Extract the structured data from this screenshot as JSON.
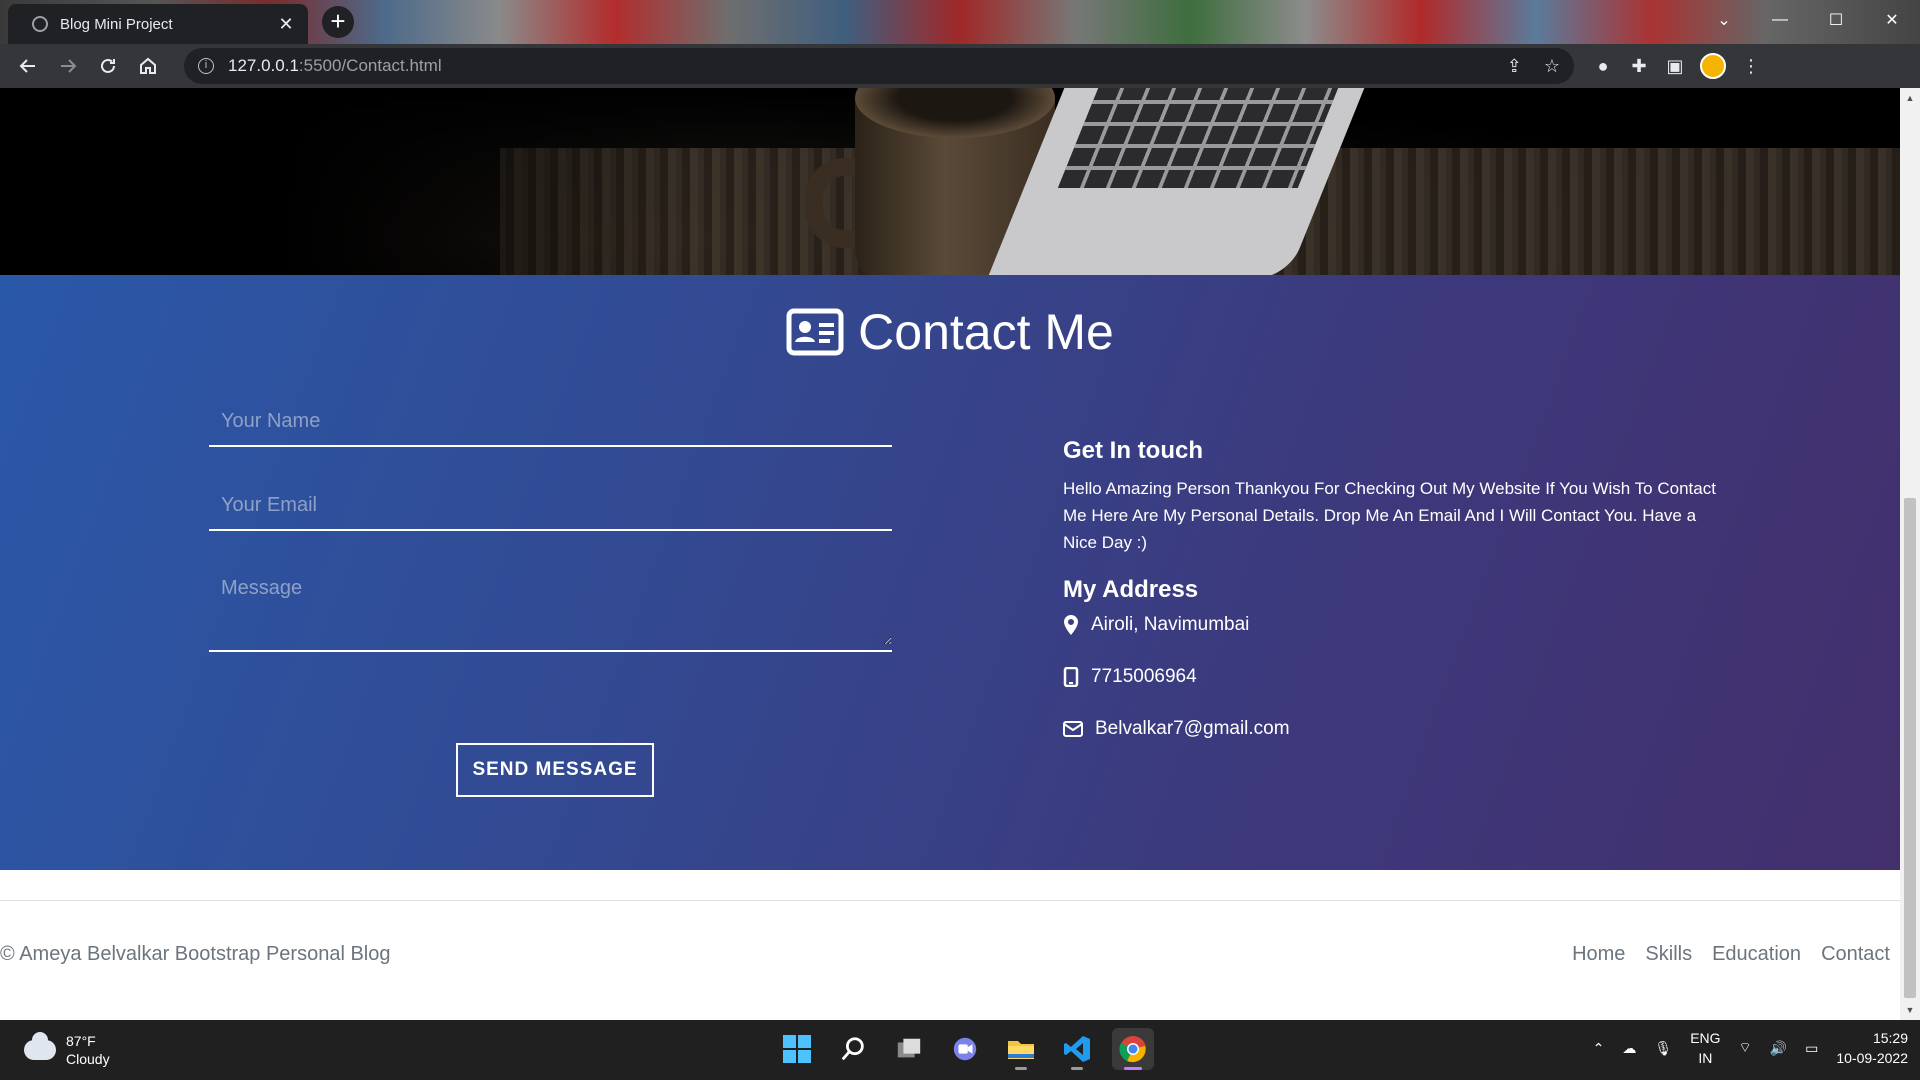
{
  "browser": {
    "tab_title": "Blog Mini Project",
    "url_host": "127.0.0.1",
    "url_path": ":5500/Contact.html"
  },
  "contact": {
    "title": "Contact Me",
    "form": {
      "name_placeholder": "Your Name",
      "email_placeholder": "Your Email",
      "message_placeholder": "Message",
      "send_label": "SEND MESSAGE"
    },
    "get_in_touch": {
      "heading": "Get In touch",
      "body": "Hello Amazing Person Thankyou For Checking Out My Website If You Wish To Contact Me Here Are My Personal Details. Drop Me An Email And I Will Contact You. Have a Nice Day :)"
    },
    "address": {
      "heading": "My Address",
      "location": "Airoli, Navimumbai",
      "phone": "7715006964",
      "email": "Belvalkar7@gmail.com"
    }
  },
  "footer": {
    "copyright": "© Ameya Belvalkar Bootstrap Personal Blog",
    "links": [
      "Home",
      "Skills",
      "Education",
      "Contact"
    ]
  },
  "taskbar": {
    "temperature": "87°F",
    "condition": "Cloudy",
    "lang_1": "ENG",
    "lang_2": "IN",
    "time": "15:29",
    "date": "10-09-2022"
  },
  "colors": {
    "gradient_start": "#2a58a8",
    "gradient_end": "#432f6c",
    "footer_text": "#6c757d"
  }
}
